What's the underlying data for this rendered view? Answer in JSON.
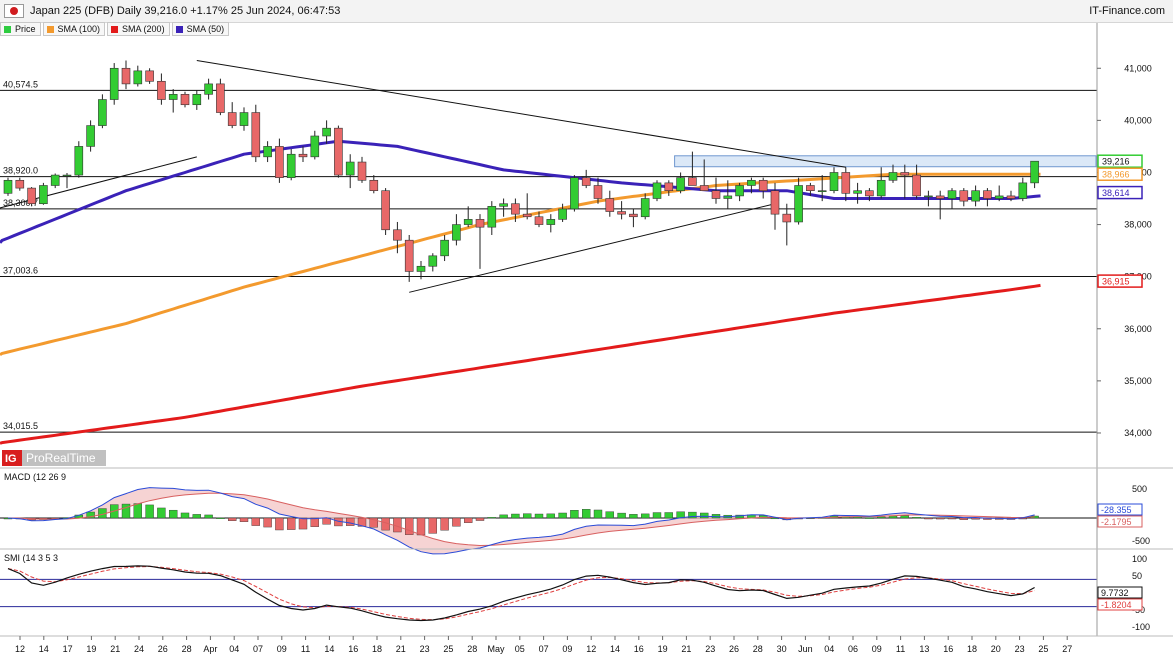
{
  "header": {
    "title": "Japan 225 (DFB) Daily 39,216.0 +1.17% 25 Jun 2024, 06:47:53",
    "brand": "IT-Finance.com"
  },
  "legend": [
    {
      "label": "Price",
      "color": "#2ecc40"
    },
    {
      "label": "SMA (100)",
      "color": "#f39a2e"
    },
    {
      "label": "SMA (200)",
      "color": "#e31b1b"
    },
    {
      "label": "SMA (50)",
      "color": "#3a22b8"
    }
  ],
  "watermark": {
    "logo": "IG",
    "text": "ProRealTime"
  },
  "colors": {
    "up": "#33cc33",
    "down": "#e86868",
    "sma50": "#3a22b8",
    "sma100": "#f39a2e",
    "sma200": "#e31b1b",
    "zone": "#dbe8f7"
  },
  "chart_data": [
    {
      "type": "candlestick",
      "x_labels": [
        "12",
        "14",
        "17",
        "19",
        "21",
        "24",
        "26",
        "28",
        "Apr",
        "04",
        "07",
        "09",
        "11",
        "14",
        "16",
        "18",
        "21",
        "23",
        "25",
        "28",
        "May",
        "05",
        "07",
        "09",
        "12",
        "14",
        "16",
        "19",
        "21",
        "23",
        "26",
        "28",
        "30",
        "Jun",
        "04",
        "06",
        "09",
        "11",
        "13",
        "16",
        "18",
        "20",
        "23",
        "25",
        "27"
      ],
      "y_ticks": [
        34000,
        35000,
        36000,
        37000,
        38000,
        39000,
        40000,
        41000
      ],
      "ylim": [
        33750,
        41600
      ],
      "horizontal_levels": [
        {
          "label": "40,574.5",
          "value": 40574.5
        },
        {
          "label": "38,920.0",
          "value": 38920
        },
        {
          "label": "38,300.7",
          "value": 38300.7
        },
        {
          "label": "37,003.6",
          "value": 37003.6
        },
        {
          "label": "34,015.5",
          "value": 34015.5
        }
      ],
      "right_badges": [
        {
          "label": "39,216",
          "value": 39216,
          "color": "#33cc33"
        },
        {
          "label": "38,966",
          "value": 38966,
          "color": "#f39a2e"
        },
        {
          "label": "38,614",
          "value": 38614,
          "color": "#3a22b8"
        },
        {
          "label": "36,915",
          "value": 36915,
          "color": "#e31b1b"
        }
      ],
      "zone": {
        "from_bar": 57,
        "y_low": 39110,
        "y_high": 39320
      },
      "trendlines": [
        {
          "from": [
            16,
            41150
          ],
          "to": [
            71,
            39100
          ]
        },
        {
          "from": [
            -1,
            38300
          ],
          "to": [
            16,
            39300
          ]
        },
        {
          "from": [
            34,
            36700
          ],
          "to": [
            65,
            38400
          ]
        }
      ],
      "candles": [
        [
          38600,
          38900,
          38550,
          38850
        ],
        [
          38850,
          38900,
          38650,
          38700
        ],
        [
          38700,
          38720,
          38350,
          38400
        ],
        [
          38400,
          38800,
          38380,
          38750
        ],
        [
          38750,
          38980,
          38700,
          38950
        ],
        [
          38950,
          38990,
          38700,
          38950
        ],
        [
          38950,
          39600,
          38900,
          39500
        ],
        [
          39500,
          40000,
          39400,
          39900
        ],
        [
          39900,
          40500,
          39850,
          40400
        ],
        [
          40400,
          41100,
          40300,
          41000
        ],
        [
          41000,
          41150,
          40600,
          40700
        ],
        [
          40700,
          41050,
          40650,
          40950
        ],
        [
          40950,
          41000,
          40700,
          40750
        ],
        [
          40750,
          40900,
          40300,
          40400
        ],
        [
          40400,
          40600,
          40150,
          40500
        ],
        [
          40500,
          40550,
          40250,
          40300
        ],
        [
          40300,
          40580,
          40200,
          40500
        ],
        [
          40500,
          40800,
          40400,
          40700
        ],
        [
          40700,
          40800,
          40100,
          40150
        ],
        [
          40150,
          40350,
          39850,
          39900
        ],
        [
          39900,
          40250,
          39800,
          40150
        ],
        [
          40150,
          40300,
          39200,
          39300
        ],
        [
          39300,
          39600,
          39200,
          39500
        ],
        [
          39500,
          39650,
          38800,
          38900
        ],
        [
          38900,
          39450,
          38850,
          39350
        ],
        [
          39350,
          39500,
          39200,
          39300
        ],
        [
          39300,
          39800,
          39250,
          39700
        ],
        [
          39700,
          40000,
          39550,
          39850
        ],
        [
          39850,
          39900,
          38900,
          38950
        ],
        [
          38950,
          39350,
          38700,
          39200
        ],
        [
          39200,
          39300,
          38800,
          38850
        ],
        [
          38850,
          38950,
          38600,
          38650
        ],
        [
          38650,
          38700,
          37800,
          37900
        ],
        [
          37900,
          38050,
          37450,
          37700
        ],
        [
          37700,
          37800,
          36900,
          37100
        ],
        [
          37100,
          37300,
          36950,
          37200
        ],
        [
          37200,
          37450,
          37100,
          37400
        ],
        [
          37400,
          37800,
          37300,
          37700
        ],
        [
          37700,
          38200,
          37600,
          38000
        ],
        [
          38000,
          38350,
          37950,
          38100
        ],
        [
          38100,
          38200,
          37150,
          37950
        ],
        [
          37950,
          38450,
          37800,
          38350
        ],
        [
          38350,
          38500,
          38150,
          38400
        ],
        [
          38400,
          38500,
          38050,
          38200
        ],
        [
          38200,
          38600,
          38100,
          38150
        ],
        [
          38150,
          38250,
          37950,
          38000
        ],
        [
          38000,
          38200,
          37850,
          38100
        ],
        [
          38100,
          38400,
          38050,
          38300
        ],
        [
          38300,
          38950,
          38250,
          38900
        ],
        [
          38900,
          39050,
          38700,
          38750
        ],
        [
          38750,
          38900,
          38400,
          38500
        ],
        [
          38500,
          38650,
          38150,
          38250
        ],
        [
          38250,
          38450,
          38100,
          38200
        ],
        [
          38200,
          38300,
          37950,
          38150
        ],
        [
          38150,
          38600,
          38100,
          38500
        ],
        [
          38500,
          38850,
          38450,
          38800
        ],
        [
          38800,
          38850,
          38550,
          38650
        ],
        [
          38650,
          39000,
          38600,
          38900
        ],
        [
          38900,
          39400,
          38800,
          38750
        ],
        [
          38750,
          39250,
          38700,
          38650
        ],
        [
          38650,
          38900,
          38400,
          38500
        ],
        [
          38500,
          38850,
          38300,
          38550
        ],
        [
          38550,
          38800,
          38450,
          38750
        ],
        [
          38750,
          38900,
          38600,
          38850
        ],
        [
          38850,
          38900,
          38500,
          38650
        ],
        [
          38650,
          38800,
          37900,
          38200
        ],
        [
          38200,
          38400,
          37600,
          38050
        ],
        [
          38050,
          38900,
          38000,
          38750
        ],
        [
          38750,
          38800,
          38550,
          38650
        ],
        [
          38650,
          38950,
          38450,
          38650
        ],
        [
          38650,
          39100,
          38600,
          39000
        ],
        [
          39000,
          39100,
          38450,
          38600
        ],
        [
          38600,
          38800,
          38400,
          38650
        ],
        [
          38650,
          38700,
          38450,
          38550
        ],
        [
          38550,
          39100,
          38500,
          38850
        ],
        [
          38850,
          39150,
          38800,
          39000
        ],
        [
          39000,
          39150,
          38500,
          38950
        ],
        [
          38950,
          39150,
          38500,
          38550
        ],
        [
          38550,
          38650,
          38350,
          38550
        ],
        [
          38550,
          38650,
          38100,
          38500
        ],
        [
          38500,
          38700,
          38300,
          38650
        ],
        [
          38650,
          38700,
          38350,
          38450
        ],
        [
          38450,
          38750,
          38350,
          38650
        ],
        [
          38650,
          38700,
          38350,
          38500
        ],
        [
          38500,
          38750,
          38450,
          38550
        ],
        [
          38550,
          38650,
          38450,
          38500
        ],
        [
          38500,
          38900,
          38450,
          38800
        ],
        [
          38800,
          39216,
          38700,
          39216
        ]
      ],
      "sma50_anchors": [
        [
          -1,
          37650
        ],
        [
          10,
          38650
        ],
        [
          20,
          39350
        ],
        [
          28,
          39600
        ],
        [
          33,
          39500
        ],
        [
          42,
          39050
        ],
        [
          52,
          38800
        ],
        [
          60,
          38650
        ],
        [
          66,
          38650
        ],
        [
          70,
          38500
        ],
        [
          77,
          38500
        ],
        [
          85,
          38500
        ],
        [
          90,
          38600
        ]
      ],
      "sma100_anchors": [
        [
          -1,
          35500
        ],
        [
          10,
          36100
        ],
        [
          20,
          36800
        ],
        [
          30,
          37400
        ],
        [
          40,
          38000
        ],
        [
          50,
          38450
        ],
        [
          60,
          38750
        ],
        [
          67,
          38850
        ],
        [
          75,
          38966
        ],
        [
          90,
          38966
        ]
      ],
      "sma200_anchors": [
        [
          -1,
          33800
        ],
        [
          15,
          34300
        ],
        [
          30,
          34900
        ],
        [
          50,
          35600
        ],
        [
          70,
          36300
        ],
        [
          85,
          36750
        ],
        [
          90,
          36915
        ]
      ]
    },
    {
      "type": "bar",
      "title": "MACD (12 26 9",
      "y_ticks": [
        "500",
        "-500"
      ],
      "right_badges": [
        "-28.355",
        "-2.1795"
      ],
      "ylim": [
        -800,
        800
      ]
    },
    {
      "type": "line",
      "title": "SMI (14 3 5 3",
      "y_ticks": [
        "100",
        "50",
        "0",
        "-50",
        "-100"
      ],
      "right_badges": [
        "9.7732",
        "-1.8204"
      ],
      "levels": [
        40,
        -40
      ],
      "ylim": [
        -120,
        120
      ]
    }
  ]
}
